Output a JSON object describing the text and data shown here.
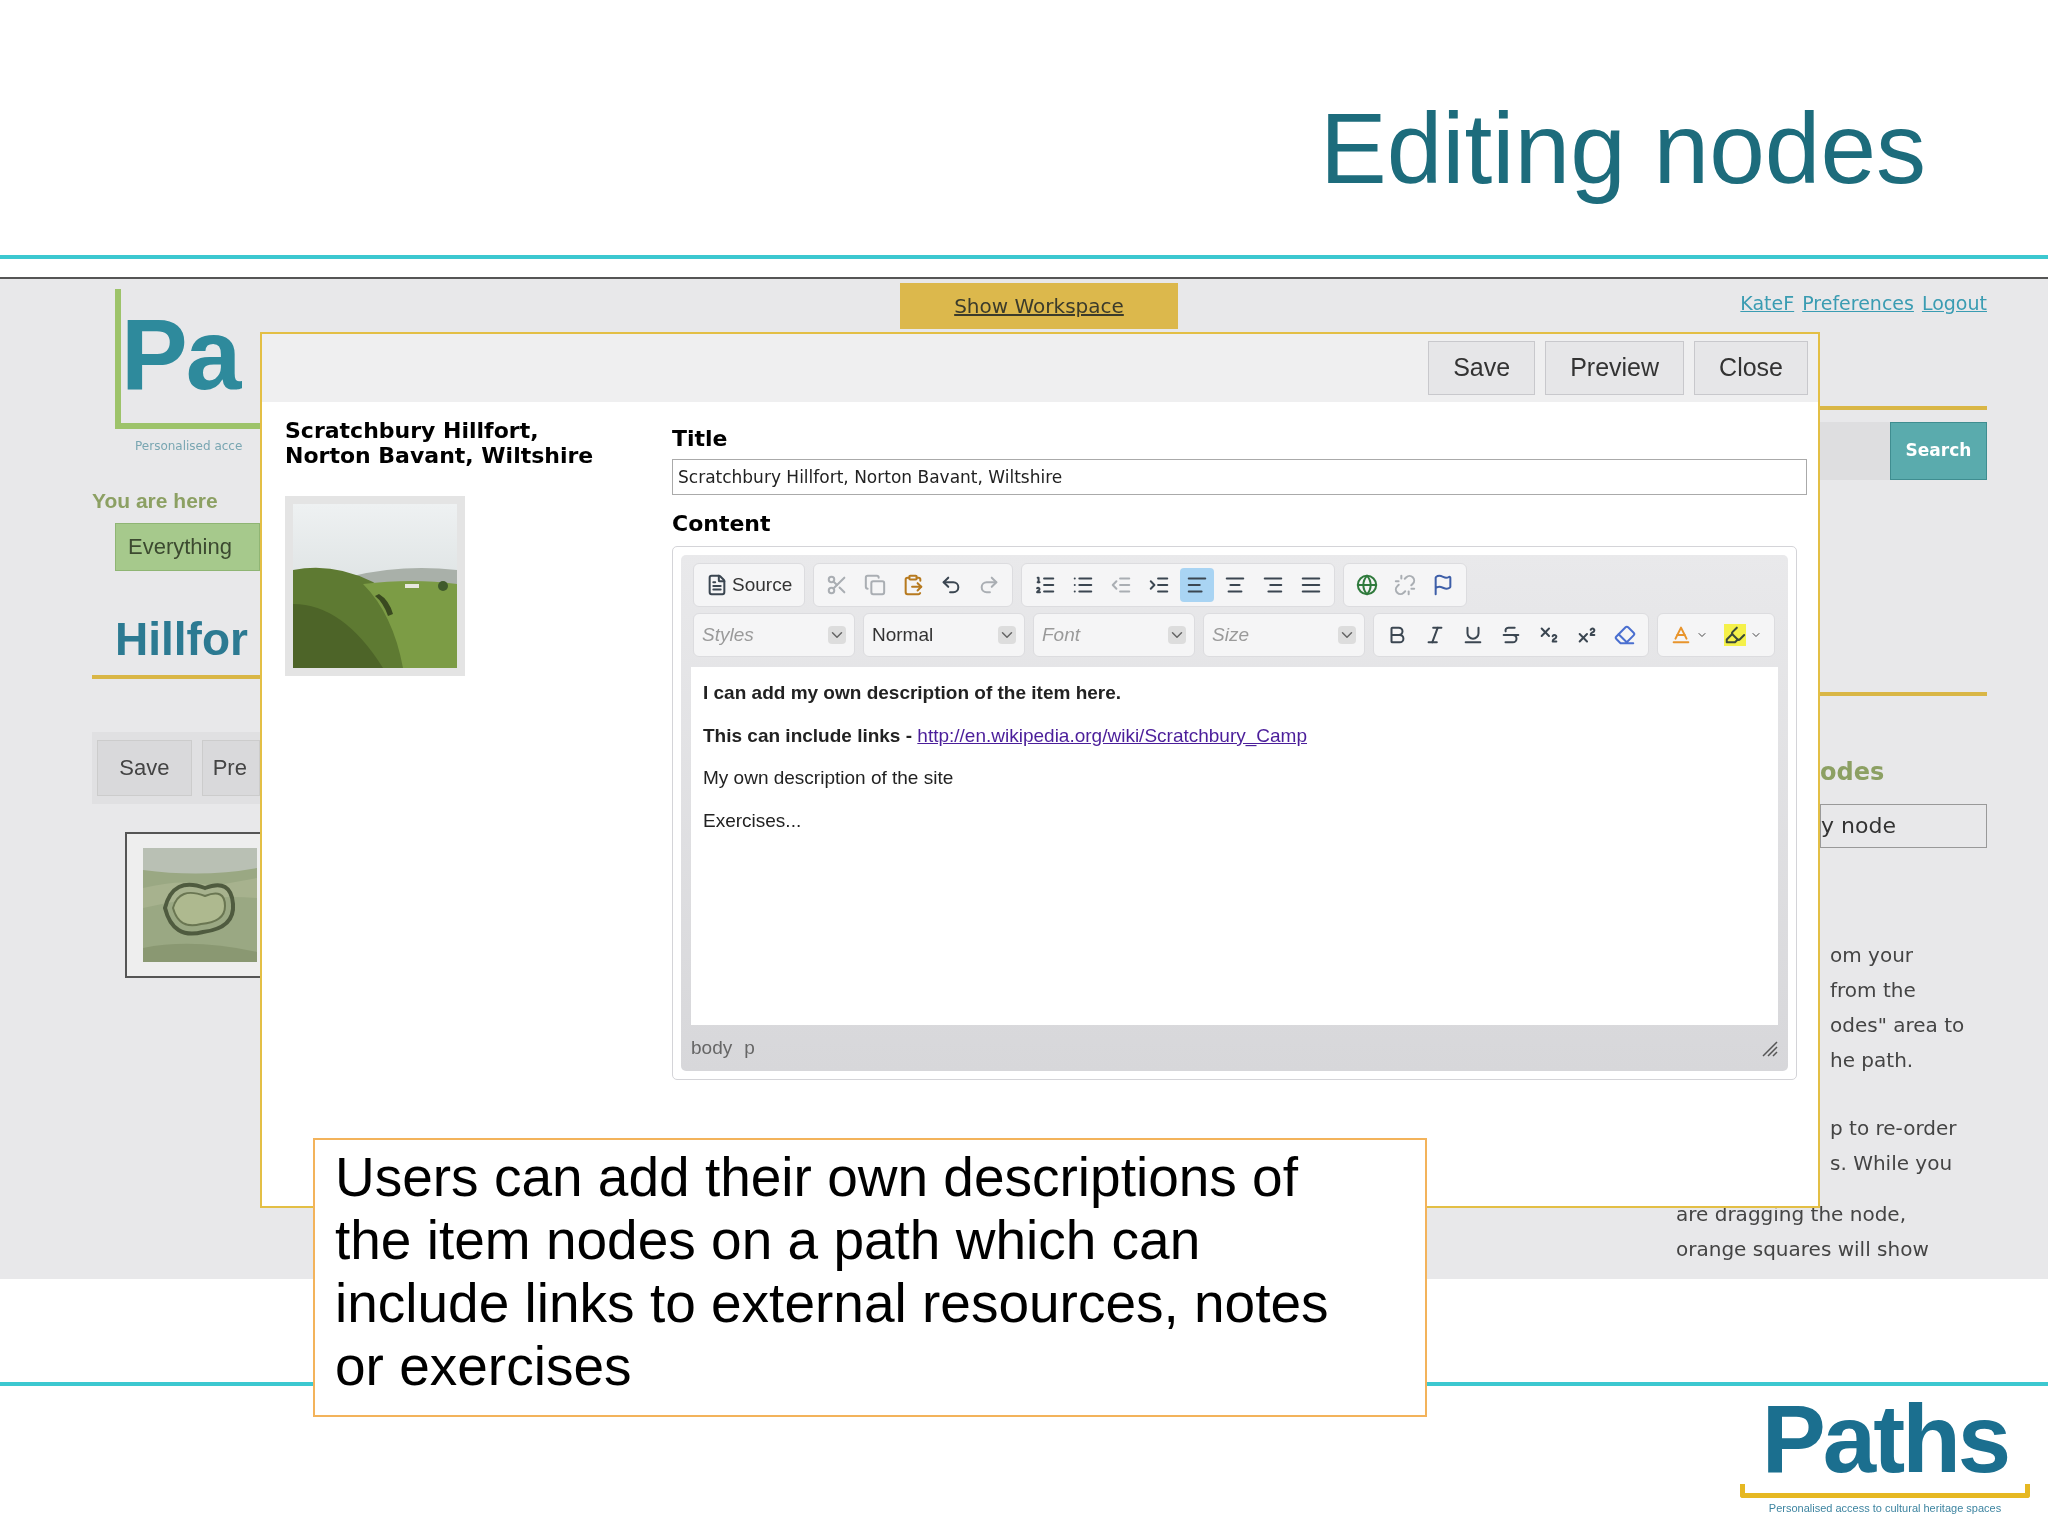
{
  "slide_title": "Editing nodes",
  "background_page": {
    "logo": "Pa",
    "tagline": "Personalised acce",
    "workspace_tab": "Show Workspace",
    "user_links": [
      "KateF",
      "Preferences",
      "Logout"
    ],
    "search_button": "Search",
    "breadcrumb_label": "You are here",
    "breadcrumb": "Everything",
    "heading": "Hillfor",
    "buttons": [
      "Save",
      "Pre"
    ],
    "nodes_heading": "odes",
    "node_field": "y node",
    "help_lines": [
      "om your",
      "from the",
      "odes\" area to",
      "he path.",
      "p to re-order",
      "s. While you",
      "are dragging the node,",
      "orange squares will show"
    ]
  },
  "dialog": {
    "buttons": [
      "Save",
      "Preview",
      "Close"
    ],
    "item_title": "Scratchbury Hillfort,\nNorton Bavant, Wiltshire",
    "title_label": "Title",
    "title_value": "Scratchbury Hillfort, Norton Bavant, Wiltshire",
    "content_label": "Content",
    "toolbar_row_1": [
      [
        {
          "kind": "source",
          "label": "Source",
          "disabled": false,
          "selected": false
        }
      ],
      [
        {
          "kind": "cut",
          "disabled": true,
          "selected": false
        },
        {
          "kind": "copy",
          "disabled": true,
          "selected": false
        },
        {
          "kind": "paste",
          "disabled": false,
          "selected": false
        },
        {
          "kind": "undo",
          "disabled": false,
          "selected": false
        },
        {
          "kind": "redo",
          "disabled": true,
          "selected": false
        }
      ],
      [
        {
          "kind": "numbered-list",
          "disabled": false,
          "selected": false
        },
        {
          "kind": "bulleted-list",
          "disabled": false,
          "selected": false
        },
        {
          "kind": "outdent",
          "disabled": true,
          "selected": false
        },
        {
          "kind": "indent",
          "disabled": false,
          "selected": false
        },
        {
          "kind": "align-left",
          "disabled": false,
          "selected": true
        },
        {
          "kind": "align-center",
          "disabled": false,
          "selected": false
        },
        {
          "kind": "align-right",
          "disabled": false,
          "selected": false
        },
        {
          "kind": "justify",
          "disabled": false,
          "selected": false
        }
      ],
      [
        {
          "kind": "link",
          "disabled": false,
          "selected": false
        },
        {
          "kind": "unlink",
          "disabled": true,
          "selected": false
        },
        {
          "kind": "anchor",
          "disabled": false,
          "selected": false
        }
      ]
    ],
    "combos": [
      {
        "placeholder": "Styles"
      },
      {
        "value": "Normal"
      },
      {
        "placeholder": "Font"
      },
      {
        "placeholder": "Size"
      }
    ],
    "toolbar_row_2": [
      [
        {
          "kind": "bold",
          "disabled": false,
          "selected": false
        },
        {
          "kind": "italic",
          "disabled": false,
          "selected": false
        },
        {
          "kind": "underline",
          "disabled": false,
          "selected": false
        },
        {
          "kind": "strike",
          "disabled": false,
          "selected": false
        },
        {
          "kind": "subscript",
          "disabled": false,
          "selected": false
        },
        {
          "kind": "superscript",
          "disabled": false,
          "selected": false
        },
        {
          "kind": "remove-format",
          "disabled": false,
          "selected": false
        }
      ],
      [
        {
          "kind": "text-color",
          "disabled": false,
          "selected": false
        },
        {
          "kind": "background-color",
          "disabled": false,
          "selected": false
        }
      ]
    ],
    "paragraphs": [
      {
        "text": "I can add my own description of the item here.",
        "bold": true
      },
      {
        "text": "This can include links - ",
        "bold": true,
        "link": "http://en.wikipedia.org/wiki/Scratchbury_Camp"
      },
      {
        "text": "My own description of the site",
        "bold": false
      },
      {
        "text": "Exercises...",
        "bold": false
      }
    ],
    "status_path": [
      "body",
      "p"
    ]
  },
  "caption": "Users can add their own descriptions of the item nodes on a path which can include links to external resources, notes or exercises",
  "footer_logo": {
    "name": "Paths",
    "tagline": "Personalised access to cultural heritage spaces"
  }
}
